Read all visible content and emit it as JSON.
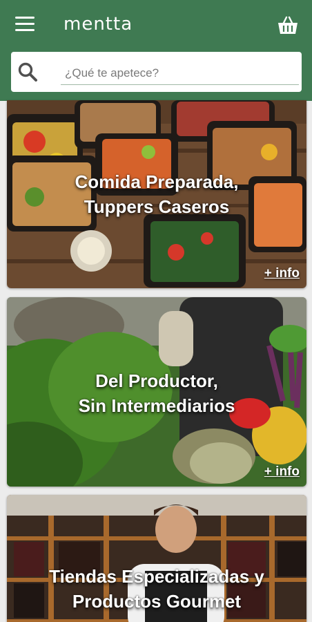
{
  "header": {
    "logo": "mentta",
    "menu_icon": "hamburger-menu-icon",
    "cart_icon": "shopping-basket-icon",
    "color": "#3f7a52"
  },
  "search": {
    "placeholder": "¿Qué te apetece?",
    "value": ""
  },
  "categories": [
    {
      "title_line1": "Comida Preparada,",
      "title_line2": "Tuppers Caseros",
      "info": "+ info"
    },
    {
      "title_line1": "Del Productor,",
      "title_line2": "Sin Intermediarios",
      "info": "+ info"
    },
    {
      "title_line1": "Tiendas Especializadas y",
      "title_line2": "Productos Gourmet"
    }
  ]
}
